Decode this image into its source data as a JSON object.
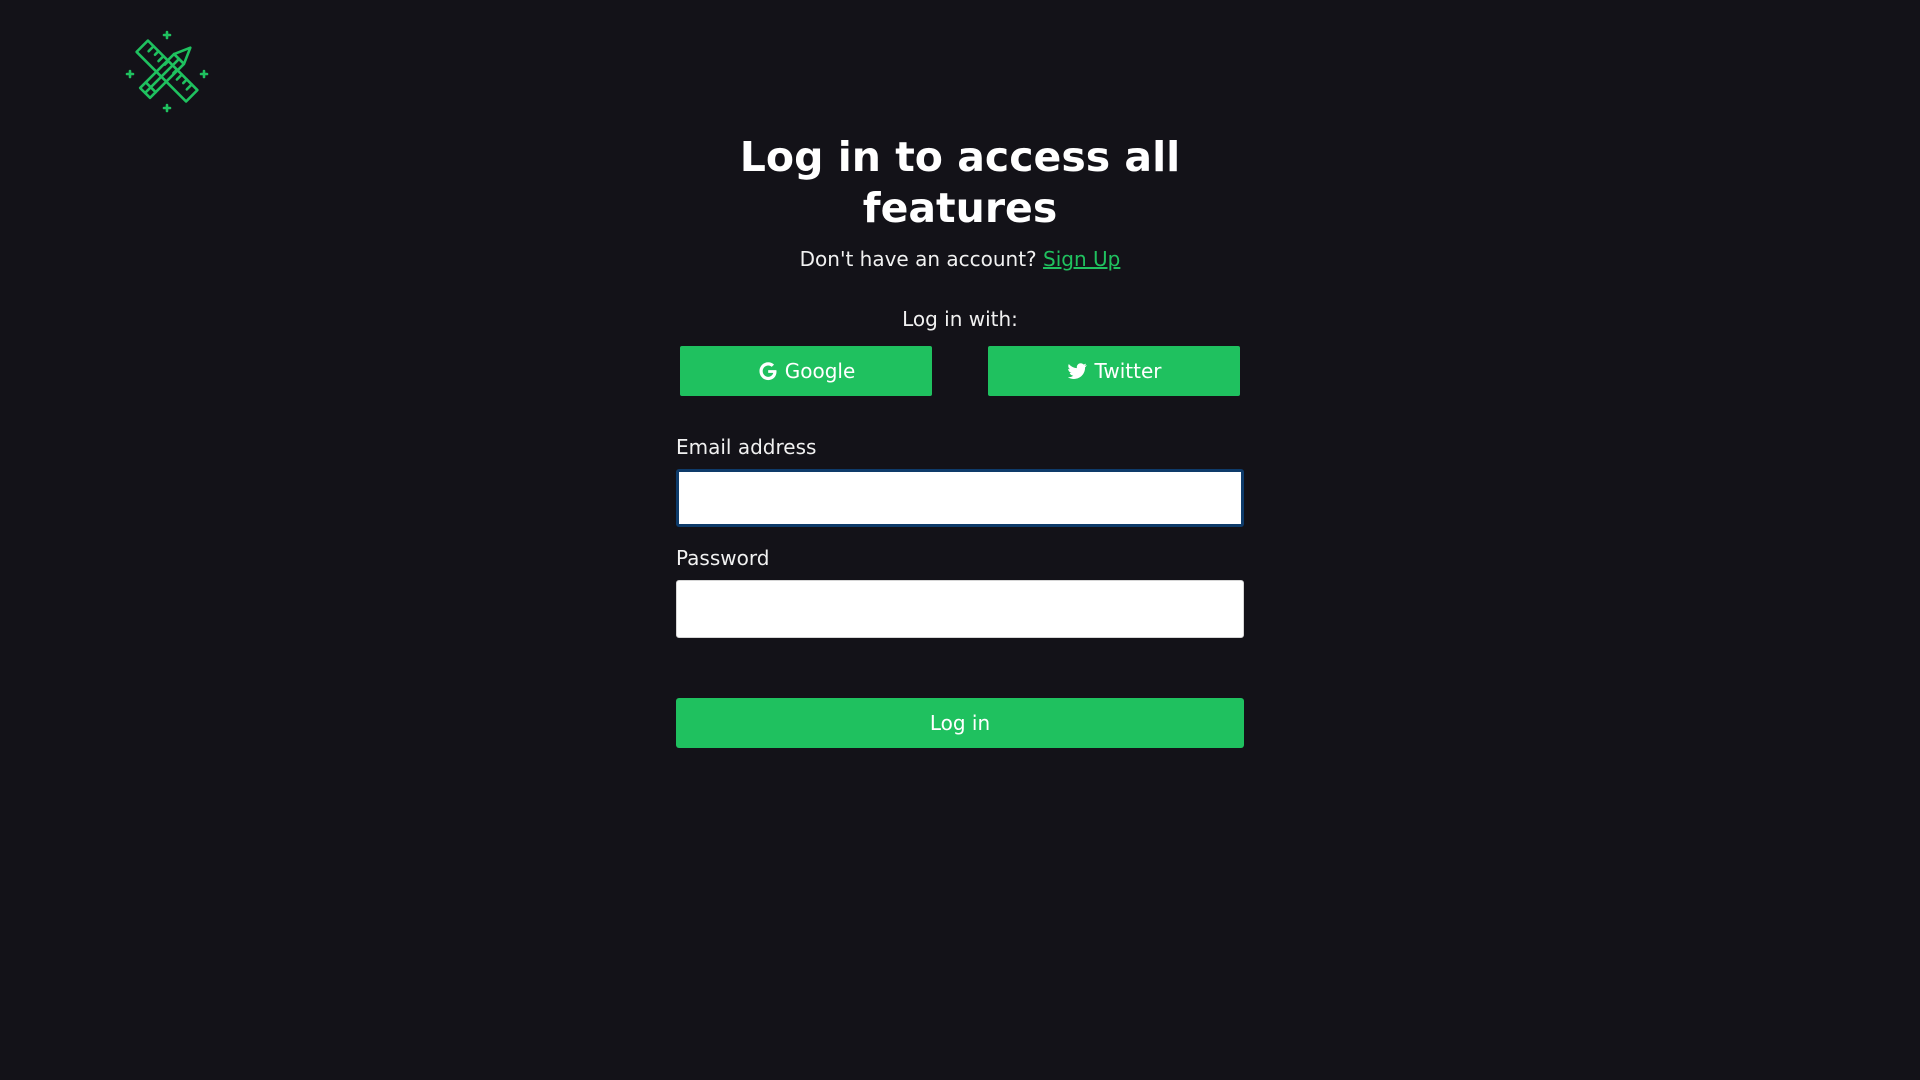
{
  "brand": {
    "logo_icon": "ruler-pencil-icon",
    "accent_color": "#1fc15f"
  },
  "heading": {
    "title": "Log in to access all features"
  },
  "signup_prompt": {
    "text": "Don't have an account?",
    "link_label": "Sign Up"
  },
  "social": {
    "prompt": "Log in with:",
    "google_label": "Google",
    "google_icon": "google-icon",
    "twitter_label": "Twitter",
    "twitter_icon": "twitter-icon"
  },
  "form": {
    "email_label": "Email address",
    "email_value": "",
    "password_label": "Password",
    "password_value": "",
    "submit_label": "Log in"
  }
}
